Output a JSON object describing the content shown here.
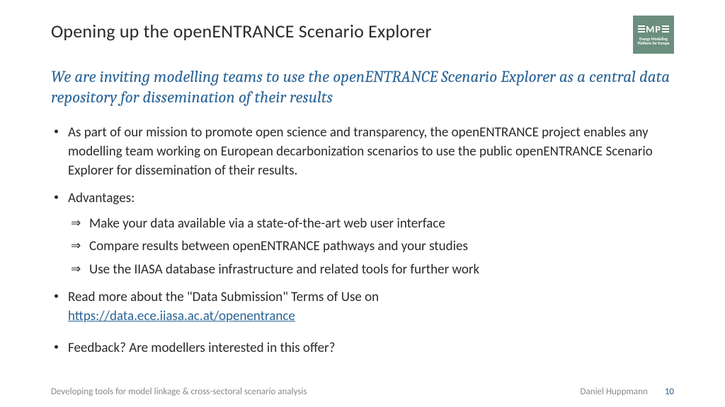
{
  "title": "Opening up the openENTRANCE Scenario Explorer",
  "logo": {
    "text": "MP",
    "sub": "Energy Modelling Platform for Europe"
  },
  "subtitle": "We are inviting modelling teams to use the openENTRANCE Scenario Explorer as a central data repository for dissemination of their results",
  "bullets": {
    "b1": "As part of our mission to promote open science and transparency, the openENTRANCE project enables any modelling team working on European decarbonization scenarios to use the public openENTRANCE Scenario Explorer for dissemination of their results.",
    "b2": "Advantages:",
    "b2_sub": {
      "s1": "Make your data available via a state-of-the-art web user interface",
      "s2": "Compare results between openENTRANCE pathways and your studies",
      "s3": "Use the IIASA database infrastructure and related tools for further work"
    },
    "b3_text": "Read more about the \"Data Submission\" Terms of Use on",
    "b3_link": "https://data.ece.iiasa.ac.at/openentrance",
    "b4": "Feedback? Are modellers interested in this offer?"
  },
  "footer": {
    "left": "Developing tools for model linkage & cross-sectoral scenario analysis",
    "author": "Daniel Huppmann",
    "page": "10"
  }
}
